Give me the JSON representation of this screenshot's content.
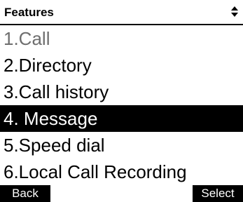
{
  "header": {
    "title": "Features",
    "scroll_icon": "up-down-scroll-arrows-icon"
  },
  "menu": {
    "items": [
      {
        "label": "1.Call",
        "state": "dimmed"
      },
      {
        "label": "2.Directory",
        "state": "normal"
      },
      {
        "label": "3.Call history",
        "state": "normal"
      },
      {
        "label": "4. Message",
        "state": "selected"
      },
      {
        "label": "5.Speed dial",
        "state": "normal"
      },
      {
        "label": "6.Local Call Recording",
        "state": "normal"
      }
    ]
  },
  "softkeys": {
    "left_label": "Back",
    "right_label": "Select"
  },
  "colors": {
    "background": "#ffffff",
    "foreground": "#000000",
    "selected_background": "#000000",
    "selected_text": "#ffffff",
    "dimmed_text": "#6e6e6e"
  }
}
